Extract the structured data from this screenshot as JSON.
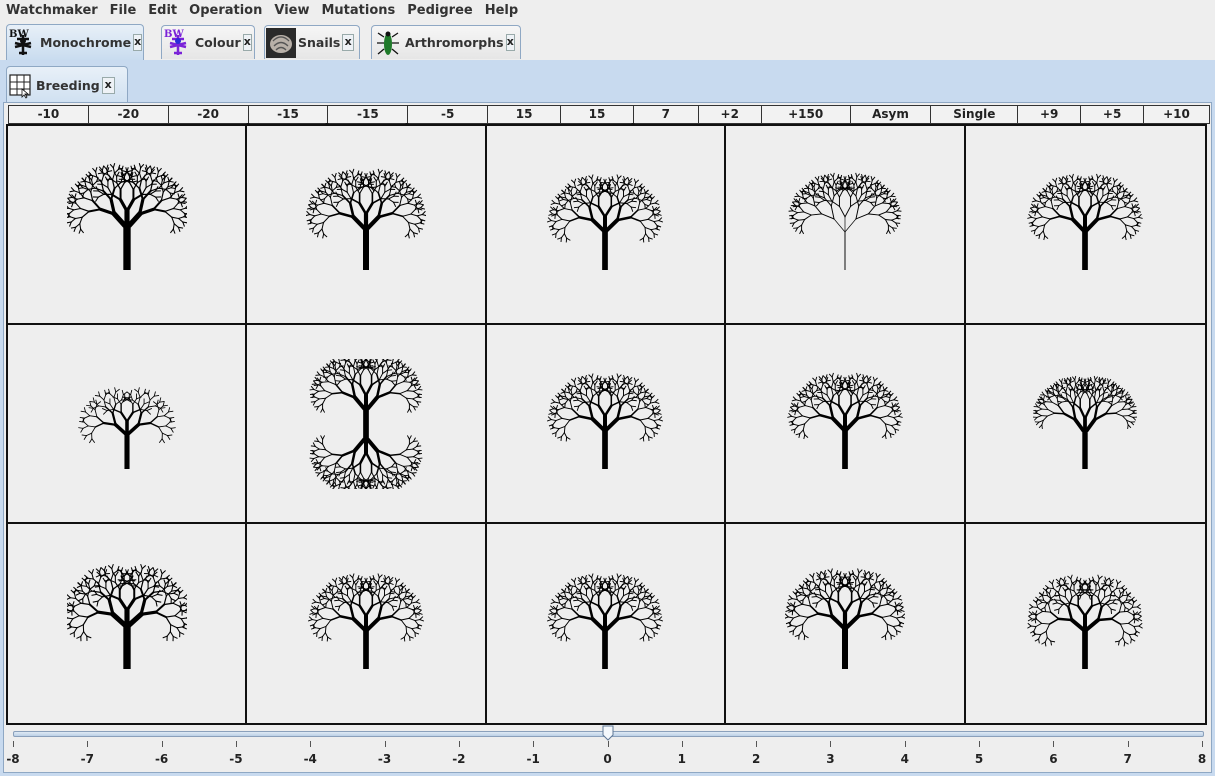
{
  "menu": [
    "Watchmaker",
    "File",
    "Edit",
    "Operation",
    "View",
    "Mutations",
    "Pedigree",
    "Help"
  ],
  "tabs": [
    {
      "label": "Monochrome",
      "close": "x",
      "icon": "biomorph-bw-icon",
      "active": true
    },
    {
      "label": "Colour",
      "close": "x",
      "icon": "biomorph-colour-icon",
      "active": false
    },
    {
      "label": "Snails",
      "close": "x",
      "icon": "snail-shell-icon",
      "active": false
    },
    {
      "label": "Arthromorphs",
      "close": "x",
      "icon": "arthromorph-icon",
      "active": false
    }
  ],
  "subtab": {
    "label": "Breeding",
    "close": "x",
    "icon": "breeding-grid-icon"
  },
  "genes": [
    "-10",
    "-20",
    "-20",
    "-15",
    "-15",
    "-5",
    "15",
    "15",
    "7",
    "+2",
    "+150",
    "Asym",
    "Single",
    "+9",
    "+5",
    "+10"
  ],
  "biomorph_icon_text": "BW",
  "slider": {
    "min": -8,
    "max": 8,
    "value": 0,
    "labels": [
      "-8",
      "-7",
      "-6",
      "-5",
      "-4",
      "-3",
      "-2",
      "-1",
      "0",
      "1",
      "2",
      "3",
      "4",
      "5",
      "6",
      "7",
      "8"
    ]
  },
  "colors": {
    "panel_bg": "#c8daef",
    "accent_border": "#8fa8c4",
    "grid_line": "#111111"
  }
}
